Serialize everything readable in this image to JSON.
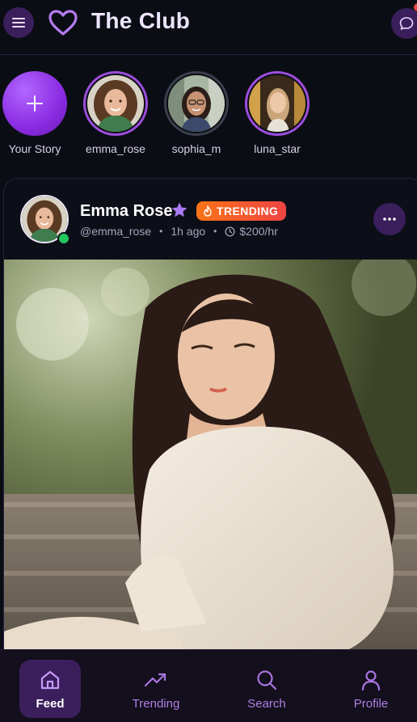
{
  "header": {
    "title": "The Club",
    "menu_icon": "hamburger-menu-icon",
    "logo_icon": "heart-outline-icon",
    "chat_icon": "chat-bubble-icon"
  },
  "stories": {
    "add_label": "Your Story",
    "items": [
      {
        "label": "emma_rose",
        "state": "active"
      },
      {
        "label": "sophia_m",
        "state": "seen"
      },
      {
        "label": "luna_star",
        "state": "active"
      }
    ]
  },
  "post": {
    "author_name": "Emma Rose",
    "badge": "TRENDING",
    "handle": "@emma_rose",
    "time": "1h ago",
    "price": "$200/hr",
    "online": true
  },
  "nav": {
    "items": [
      {
        "label": "Feed",
        "icon": "home-icon",
        "active": true
      },
      {
        "label": "Trending",
        "icon": "trending-up-icon",
        "active": false
      },
      {
        "label": "Search",
        "icon": "search-icon",
        "active": false
      },
      {
        "label": "Profile",
        "icon": "user-icon",
        "active": false
      }
    ]
  },
  "colors": {
    "background": "#0b0d14",
    "accent": "#9d4edd",
    "badge_start": "#f97316",
    "badge_end": "#ef4444",
    "online": "#22c55e"
  }
}
